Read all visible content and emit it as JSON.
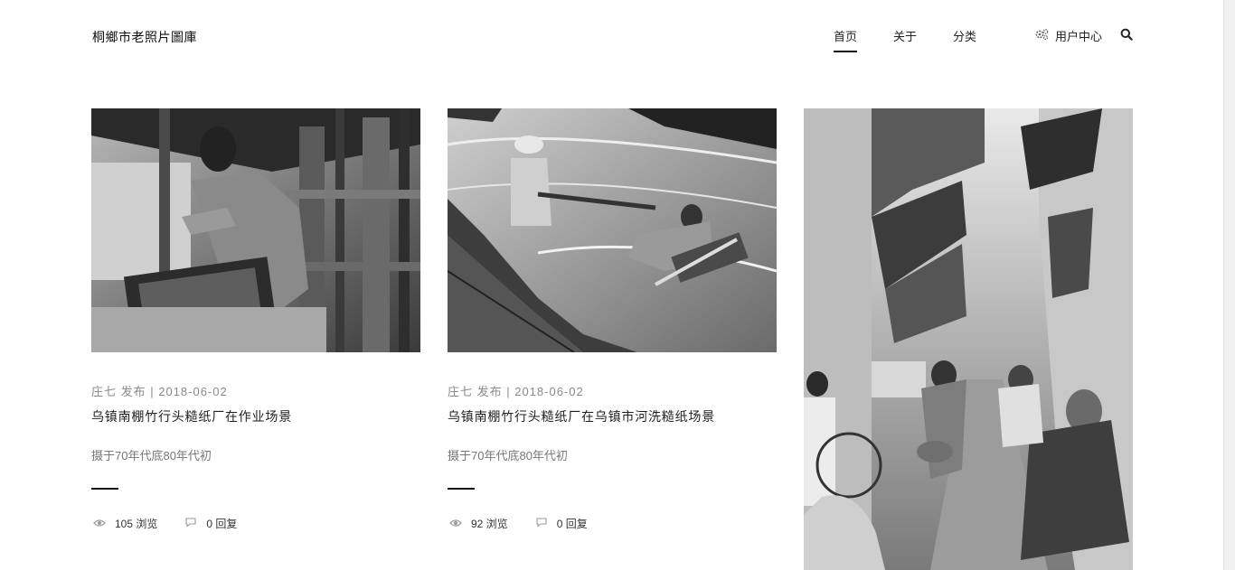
{
  "site": {
    "logo": "桐鄉市老照片圖庫"
  },
  "nav": {
    "items": [
      {
        "label": "首页"
      },
      {
        "label": "关于"
      },
      {
        "label": "分类"
      }
    ]
  },
  "header": {
    "user_center": "用户中心",
    "user_icon": "gears-icon",
    "search_icon": "search-icon"
  },
  "posts": [
    {
      "meta": "庄七 发布 | 2018-06-02",
      "title": "乌镇南棚竹行头糙纸厂在作业场景",
      "desc": "摄于70年代底80年代初",
      "views": "105 浏览",
      "replies": "0 回复"
    },
    {
      "meta": "庄七 发布 | 2018-06-02",
      "title": "乌镇南棚竹行头糙纸厂在乌镇市河洗糙纸场景",
      "desc": "摄于70年代底80年代初",
      "views": "92 浏览",
      "replies": "0 回复"
    }
  ],
  "icons": {
    "views": "eye-icon",
    "replies": "comment-icon"
  },
  "colors": {
    "text": "#222222",
    "muted": "#8a8a8a",
    "accent": "#111111"
  }
}
